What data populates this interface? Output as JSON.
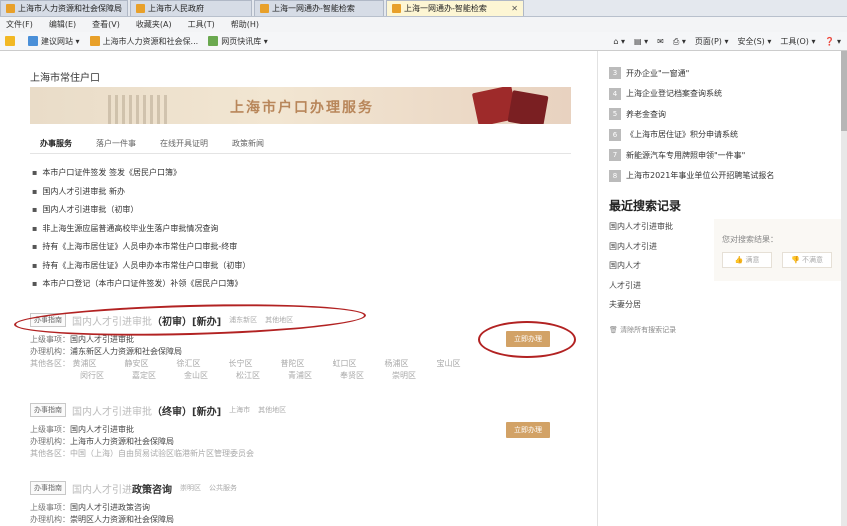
{
  "browser": {
    "tabs": [
      "上海市人力资源和社会保障局",
      "上海市人民政府",
      "上海一网通办-智能检索",
      "上海一网通办-智能检索"
    ],
    "menu": [
      "文件(F)",
      "编辑(E)",
      "查看(V)",
      "收藏夹(A)",
      "工具(T)",
      "帮助(H)"
    ],
    "favorites": [
      "建议网站 ▾",
      "上海市人力资源和社会保...",
      "网页快讯库 ▾"
    ],
    "tools": [
      "⌂ ▾",
      "▤ ▾",
      "✉",
      "⎙ ▾",
      "页面(P) ▾",
      "安全(S) ▾",
      "工具(O) ▾",
      "❓ ▾"
    ]
  },
  "page": {
    "title": "上海市常住户口",
    "banner": "上海市户口办理服务",
    "subtabs": [
      "办事服务",
      "落户一件事",
      "在线开具证明",
      "政策新闻"
    ],
    "bullets": [
      "本市户口证件签发 签发《居民户口簿》",
      "国内人才引进审批 新办",
      "国内人才引进审批（初审）",
      "非上海生源应届普通高校毕业生落户审批情况查询",
      "持有《上海市居住证》人员申办本市常住户口审批-终审",
      "持有《上海市居住证》人员申办本市常住户口审批（初审）",
      "本市户口登记（本市户口证件签发）补领《居民户口簿》"
    ],
    "services": [
      {
        "tag": "办事指南",
        "name_pre": "国内人才引进审批",
        "name_bold": "（初审）[新办]",
        "mini1": "浦东新区",
        "mini2": "其他地区",
        "superior_lbl": "上级事项：",
        "superior": "国内人才引进审批",
        "org_lbl": "办理机构：",
        "org": "浦东新区人力资源和社会保障局",
        "other_lbl": "其他各区：",
        "districts1": [
          "黄浦区",
          "静安区",
          "徐汇区",
          "长宁区",
          "普陀区",
          "虹口区",
          "杨浦区",
          "宝山区"
        ],
        "districts2": [
          "闵行区",
          "嘉定区",
          "金山区",
          "松江区",
          "青浦区",
          "奉贤区",
          "崇明区"
        ],
        "btn": "立即办理"
      },
      {
        "tag": "办事指南",
        "name_pre": "国内人才引进审批",
        "name_bold": "（终审）[新办]",
        "mini1": "上海市",
        "mini2": "其他地区",
        "superior_lbl": "上级事项：",
        "superior": "国内人才引进审批",
        "org_lbl": "办理机构：",
        "org": "上海市人力资源和社会保障局",
        "other_lbl": "其他各区：",
        "other": "中国（上海）自由贸易试验区临港新片区管理委员会",
        "btn": "立即办理"
      },
      {
        "tag": "办事指南",
        "name_pre": "国内人才引进",
        "name_bold": "政策咨询",
        "mini1": "崇明区",
        "mini2": "公共服务",
        "superior_lbl": "上级事项：",
        "superior": "国内人才引进政策咨询",
        "org_lbl": "办理机构：",
        "org": "崇明区人力资源和社会保障局"
      }
    ]
  },
  "side": {
    "list": [
      {
        "n": "3",
        "t": "开办企业\"一窗通\""
      },
      {
        "n": "4",
        "t": "上海企业登记档案查询系统"
      },
      {
        "n": "5",
        "t": "养老金查询"
      },
      {
        "n": "6",
        "t": "《上海市居住证》积分申请系统"
      },
      {
        "n": "7",
        "t": "新能源汽车专用牌照申领\"一件事\""
      },
      {
        "n": "8",
        "t": "上海市2021年事业单位公开招聘笔试报名"
      }
    ],
    "recent_title": "最近搜索记录",
    "recent": [
      "国内人才引进审批",
      "国内人才引进",
      "国内人才",
      "人才引进",
      "夫妻分居"
    ],
    "clear": "清除所有搜索记录",
    "feedback_q": "您对搜索结果：",
    "feedback_yes": "满意",
    "feedback_no": "不满意"
  },
  "colors": {
    "accent": "#d2a266",
    "annotation": "#b22222",
    "banner_text": "#b8865a"
  }
}
